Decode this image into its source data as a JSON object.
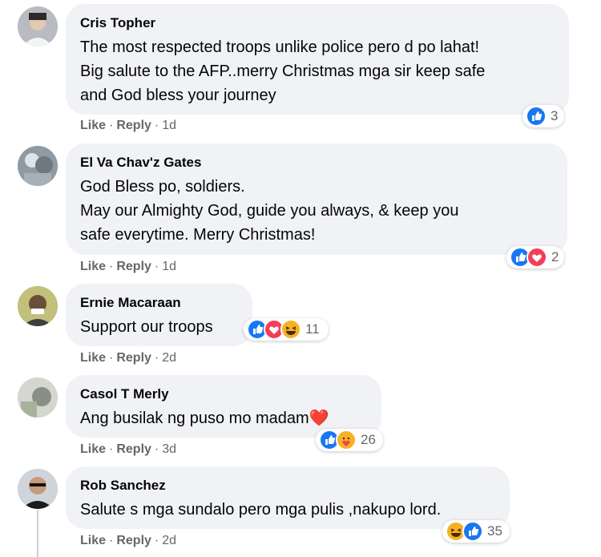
{
  "comments": [
    {
      "author": "Cris Topher",
      "text": "The most respected troops unlike police pero d po lahat!\nBig salute to the AFP..merry Christmas mga sir keep safe\nand God bless your journey",
      "like_label": "Like",
      "reply_label": "Reply",
      "time": "1d",
      "reaction_count": "3",
      "reactions": [
        "like-icon"
      ]
    },
    {
      "author": "El Va Chav'z Gates",
      "text": "God Bless po, soldiers.\nMay our Almighty God, guide you always, & keep you\nsafe everytime. Merry Christmas!",
      "like_label": "Like",
      "reply_label": "Reply",
      "time": "1d",
      "reaction_count": "2",
      "reactions": [
        "like-icon",
        "love-icon"
      ]
    },
    {
      "author": "Ernie Macaraan",
      "text": "Support our troops",
      "like_label": "Like",
      "reply_label": "Reply",
      "time": "2d",
      "reaction_count": "11",
      "reactions": [
        "like-icon",
        "love-icon",
        "haha-icon"
      ]
    },
    {
      "author": "Casol T Merly",
      "text": "Ang busilak ng puso mo madam❤️",
      "like_label": "Like",
      "reply_label": "Reply",
      "time": "3d",
      "reaction_count": "26",
      "reactions": [
        "like-icon",
        "care-icon"
      ]
    },
    {
      "author": "Rob Sanchez",
      "text": "Salute s mga sundalo pero mga pulis ,nakupo lord.",
      "like_label": "Like",
      "reply_label": "Reply",
      "time": "2d",
      "reaction_count": "35",
      "reactions": [
        "haha-icon",
        "like-icon"
      ]
    }
  ],
  "separator": "·",
  "colors": {
    "bubble": "#f0f2f5",
    "like_blue": "#1877f2",
    "love_red": "#f33e58",
    "haha_yellow": "#f7b125",
    "meta_gray": "#65676b"
  }
}
